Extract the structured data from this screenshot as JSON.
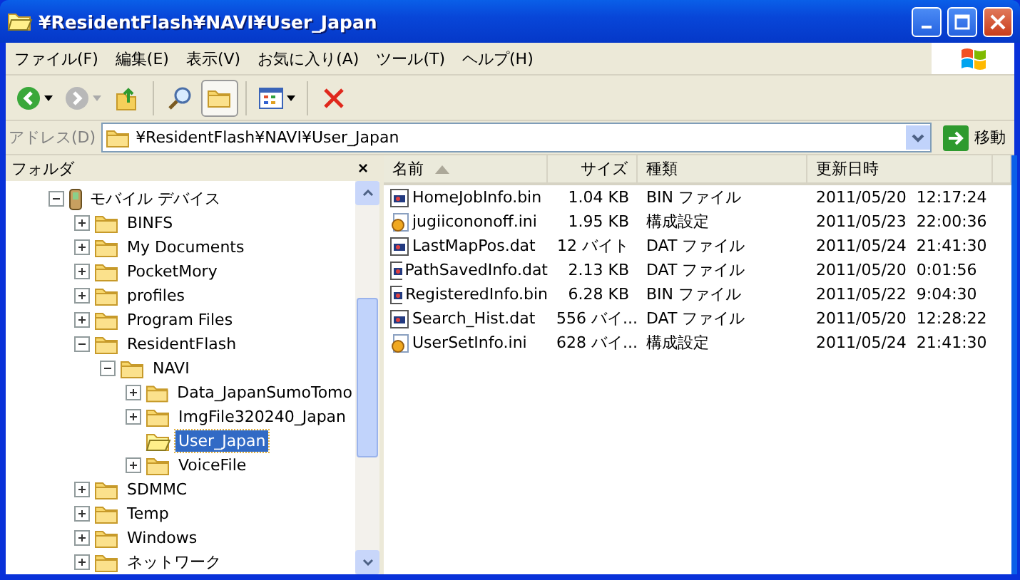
{
  "window": {
    "title": "¥ResidentFlash¥NAVI¥User_Japan"
  },
  "menu": [
    "ファイル(F)",
    "編集(E)",
    "表示(V)",
    "お気に入り(A)",
    "ツール(T)",
    "ヘルプ(H)"
  ],
  "toolbar": [
    {
      "kind": "back",
      "pressed": false
    },
    {
      "kind": "forward",
      "pressed": false
    },
    {
      "kind": "up",
      "pressed": false
    },
    {
      "kind": "search",
      "pressed": false
    },
    {
      "kind": "folders",
      "pressed": true
    },
    {
      "kind": "views",
      "pressed": false
    },
    {
      "kind": "delete",
      "pressed": false
    }
  ],
  "address": {
    "label": "アドレス(D)",
    "value": "¥ResidentFlash¥NAVI¥User_Japan",
    "go": "移動"
  },
  "folder_pane": {
    "title": "フォルダ",
    "close": "×",
    "tree": [
      {
        "label": "モバイル デバイス",
        "kind": "device",
        "expanded": true,
        "selected": false,
        "children": [
          {
            "label": "BINFS",
            "kind": "folder",
            "expanded": false,
            "selected": false
          },
          {
            "label": "My Documents",
            "kind": "folder",
            "expanded": false,
            "selected": false
          },
          {
            "label": "PocketMory",
            "kind": "folder",
            "expanded": false,
            "selected": false
          },
          {
            "label": "profiles",
            "kind": "folder",
            "expanded": false,
            "selected": false
          },
          {
            "label": "Program Files",
            "kind": "folder",
            "expanded": false,
            "selected": false
          },
          {
            "label": "ResidentFlash",
            "kind": "folder",
            "expanded": true,
            "selected": false,
            "children": [
              {
                "label": "NAVI",
                "kind": "folder",
                "expanded": true,
                "selected": false,
                "children": [
                  {
                    "label": "Data_JapanSumoTomo",
                    "kind": "folder",
                    "expanded": false,
                    "selected": false
                  },
                  {
                    "label": "ImgFile320240_Japan",
                    "kind": "folder",
                    "expanded": false,
                    "selected": false
                  },
                  {
                    "label": "User_Japan",
                    "kind": "open-folder",
                    "selected": true
                  },
                  {
                    "label": "VoiceFile",
                    "kind": "folder",
                    "expanded": false,
                    "selected": false
                  }
                ]
              }
            ]
          },
          {
            "label": "SDMMC",
            "kind": "folder",
            "expanded": false,
            "selected": false
          },
          {
            "label": "Temp",
            "kind": "folder",
            "expanded": false,
            "selected": false
          },
          {
            "label": "Windows",
            "kind": "folder",
            "expanded": false,
            "selected": false
          },
          {
            "label": "ネットワーク",
            "kind": "folder",
            "expanded": false,
            "selected": false
          }
        ]
      }
    ]
  },
  "file_list": {
    "columns": [
      {
        "label": "名前",
        "sorted": true
      },
      {
        "label": "サイズ",
        "sorted": false
      },
      {
        "label": "種類",
        "sorted": false
      },
      {
        "label": "更新日時",
        "sorted": false
      }
    ],
    "rows": [
      {
        "kind": "binary",
        "name": "HomeJobInfo.bin",
        "size": "1.04 KB",
        "type": "BIN ファイル",
        "modified": "2011/05/20  12:17:24"
      },
      {
        "kind": "settings",
        "name": "jugiicononoff.ini",
        "size": "1.95 KB",
        "type": "構成設定",
        "modified": "2011/05/23  22:00:36"
      },
      {
        "kind": "binary",
        "name": "LastMapPos.dat",
        "size": "12 バイト",
        "type": "DAT ファイル",
        "modified": "2011/05/24  21:41:30"
      },
      {
        "kind": "binary",
        "name": "PathSavedInfo.dat",
        "size": "2.13 KB",
        "type": "DAT ファイル",
        "modified": "2011/05/20  0:01:56"
      },
      {
        "kind": "binary",
        "name": "RegisteredInfo.bin",
        "size": "6.28 KB",
        "type": "BIN ファイル",
        "modified": "2011/05/22  9:04:30"
      },
      {
        "kind": "binary",
        "name": "Search_Hist.dat",
        "size": "556 バイ...",
        "type": "DAT ファイル",
        "modified": "2011/05/20  12:28:22"
      },
      {
        "kind": "settings",
        "name": "UserSetInfo.ini",
        "size": "628 バイ...",
        "type": "構成設定",
        "modified": "2011/05/24  21:41:30"
      }
    ]
  }
}
